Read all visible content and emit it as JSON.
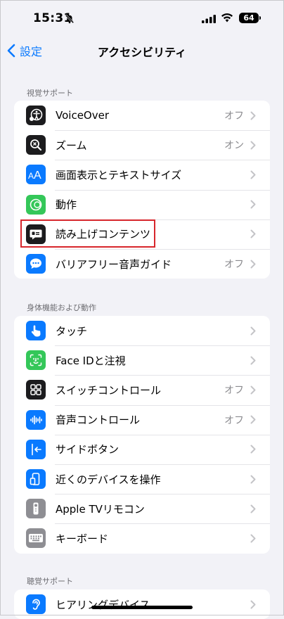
{
  "status_bar": {
    "time": "15:31",
    "battery": "64"
  },
  "nav": {
    "back_label": "設定",
    "title": "アクセシビリティ"
  },
  "sections": [
    {
      "header": "視覚サポート",
      "items": [
        {
          "label": "VoiceOver",
          "value": "オフ",
          "icon": "voiceover-icon",
          "color": "#1c1c1e"
        },
        {
          "label": "ズーム",
          "value": "オン",
          "icon": "zoom-icon",
          "color": "#1c1c1e"
        },
        {
          "label": "画面表示とテキストサイズ",
          "value": "",
          "icon": "text-size-icon",
          "color": "#0a7aff"
        },
        {
          "label": "動作",
          "value": "",
          "icon": "motion-icon",
          "color": "#34c759"
        },
        {
          "label": "読み上げコンテンツ",
          "value": "",
          "icon": "spoken-content-icon",
          "color": "#1c1c1e"
        },
        {
          "label": "バリアフリー音声ガイド",
          "value": "オフ",
          "icon": "audio-description-icon",
          "color": "#0a7aff"
        }
      ]
    },
    {
      "header": "身体機能および動作",
      "items": [
        {
          "label": "タッチ",
          "value": "",
          "icon": "touch-icon",
          "color": "#0a7aff"
        },
        {
          "label": "Face IDと注視",
          "value": "",
          "icon": "face-id-icon",
          "color": "#34c759"
        },
        {
          "label": "スイッチコントロール",
          "value": "オフ",
          "icon": "switch-control-icon",
          "color": "#1c1c1e"
        },
        {
          "label": "音声コントロール",
          "value": "オフ",
          "icon": "voice-control-icon",
          "color": "#0a7aff"
        },
        {
          "label": "サイドボタン",
          "value": "",
          "icon": "side-button-icon",
          "color": "#0a7aff"
        },
        {
          "label": "近くのデバイスを操作",
          "value": "",
          "icon": "nearby-devices-icon",
          "color": "#0a7aff"
        },
        {
          "label": "Apple TVリモコン",
          "value": "",
          "icon": "apple-tv-remote-icon",
          "color": "#8e8e93"
        },
        {
          "label": "キーボード",
          "value": "",
          "icon": "keyboard-icon",
          "color": "#8e8e93"
        }
      ]
    },
    {
      "header": "聴覚サポート",
      "items": [
        {
          "label": "ヒアリングデバイス",
          "value": "",
          "icon": "hearing-devices-icon",
          "color": "#0a7aff"
        }
      ]
    }
  ]
}
